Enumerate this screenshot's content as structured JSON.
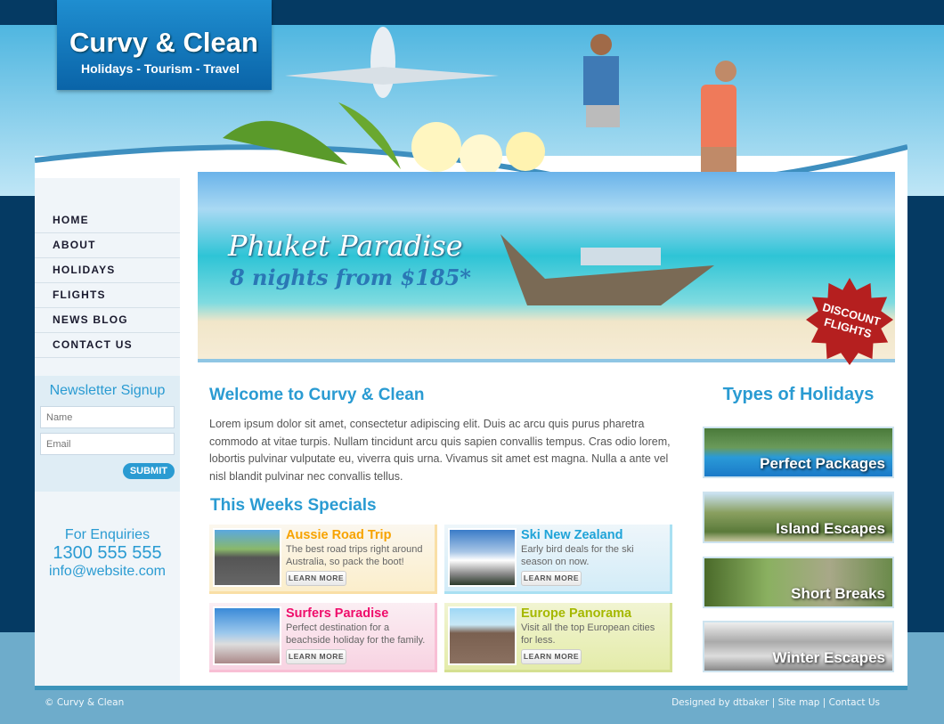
{
  "logo": {
    "title": "Curvy & Clean",
    "tagline": "Holidays - Tourism - Travel"
  },
  "nav": [
    "HOME",
    "ABOUT",
    "HOLIDAYS",
    "FLIGHTS",
    "NEWS BLOG",
    "CONTACT US"
  ],
  "newsletter": {
    "title": "Newsletter Signup",
    "name_placeholder": "Name",
    "email_placeholder": "Email",
    "submit": "SUBMIT"
  },
  "enquiries": {
    "label": "For Enquiries",
    "phone": "1300 555 555",
    "email": "info@website.com"
  },
  "banner": {
    "title": "Phuket Paradise",
    "subtitle": "8 nights from $185*",
    "badge": [
      "DISCOUNT",
      "FLIGHTS"
    ]
  },
  "welcome": {
    "title": "Welcome to Curvy & Clean",
    "text": "Lorem ipsum dolor sit amet, consectetur adipiscing elit. Duis ac arcu quis purus pharetra commodo at vitae turpis. Nullam tincidunt arcu quis sapien convallis tempus. Cras odio lorem, lobortis pulvinar vulputate eu, viverra quis urna. Vivamus sit amet est magna. Nulla a ante vel nisl blandit pulvinar nec convallis tellus."
  },
  "specials": {
    "title": "This Weeks Specials",
    "learn_more": "LEARN MORE",
    "items": [
      {
        "title": "Aussie Road Trip",
        "text": "The best road trips right around Australia, so pack the boot!",
        "color": "#f7a300"
      },
      {
        "title": "Ski New Zealand",
        "text": "Early bird deals for the ski season on now.",
        "color": "#1fa3d8"
      },
      {
        "title": "Surfers Paradise",
        "text": "Perfect destination for a beachside holiday for the family.",
        "color": "#ef0d6b"
      },
      {
        "title": "Europe Panorama",
        "text": "Visit all the top European cities for less.",
        "color": "#a5b800"
      }
    ]
  },
  "types": {
    "title": "Types of Holidays",
    "items": [
      "Perfect Packages",
      "Island Escapes",
      "Short Breaks",
      "Winter Escapes"
    ]
  },
  "footer": {
    "copyright": "© Curvy & Clean",
    "links": [
      "Designed by dtbaker",
      "Site map",
      "Contact Us"
    ]
  }
}
